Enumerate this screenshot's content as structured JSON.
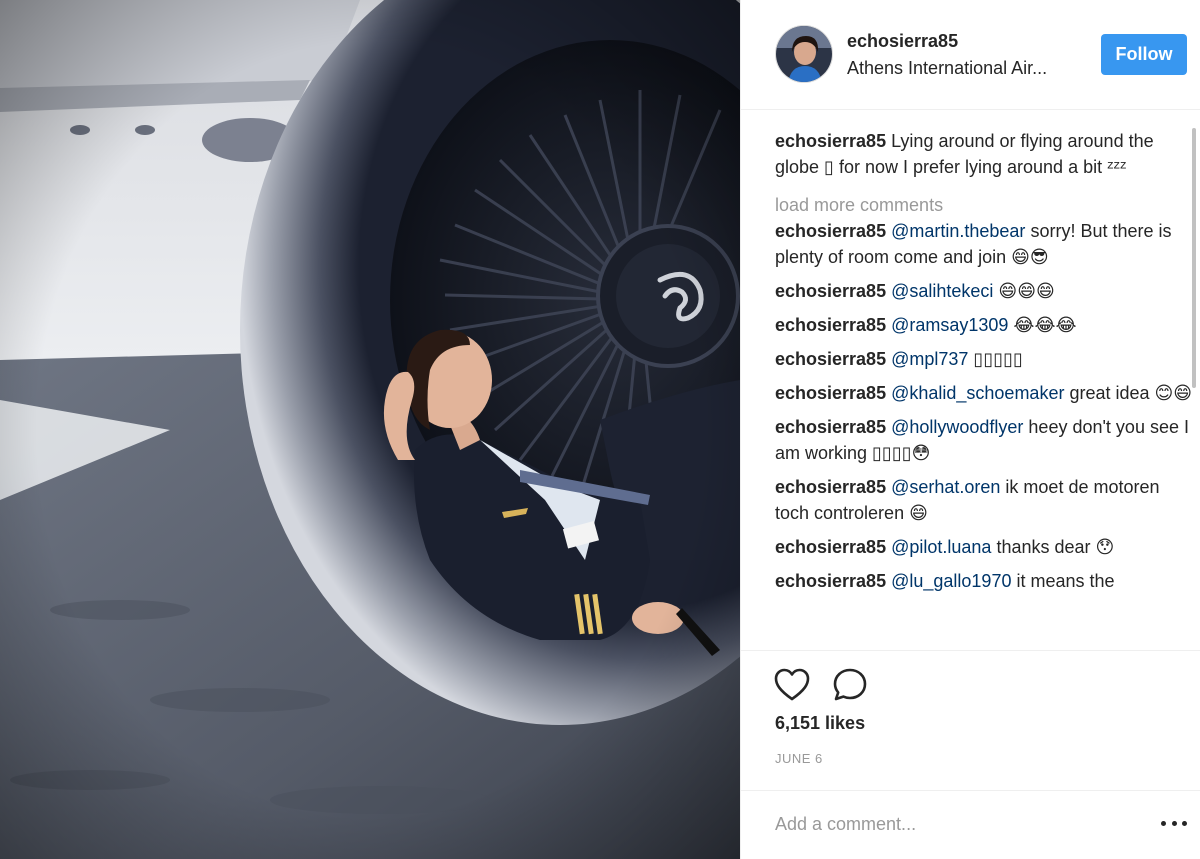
{
  "post": {
    "username": "echosierra85",
    "location": "Athens International Air...",
    "follow_label": "Follow",
    "caption": {
      "user": "echosierra85",
      "text": "Lying around or flying around the globe ▯ for now I prefer lying around a bit ᶻᶻᶻ"
    },
    "load_more": "load more comments",
    "comments": [
      {
        "user": "echosierra85",
        "mention": "@martin.thebear",
        "text": " sorry! But there is plenty of room come and join 😄😎"
      },
      {
        "user": "echosierra85",
        "mention": "@salihtekeci",
        "text": " 😄😄😄"
      },
      {
        "user": "echosierra85",
        "mention": "@ramsay1309",
        "text": " 😂😂😂"
      },
      {
        "user": "echosierra85",
        "mention": "@mpl737",
        "text": " ▯▯▯▯▯"
      },
      {
        "user": "echosierra85",
        "mention": "@khalid_schoemaker",
        "text": " great idea 😊😄"
      },
      {
        "user": "echosierra85",
        "mention": "@hollywoodflyer",
        "text": " heey don't you see I am working ▯▯▯▯😳"
      },
      {
        "user": "echosierra85",
        "mention": "@serhat.oren",
        "text": " ik moet de motoren toch controleren 😄"
      },
      {
        "user": "echosierra85",
        "mention": "@pilot.luana",
        "text": " thanks dear 😯"
      },
      {
        "user": "echosierra85",
        "mention": "@lu_gallo1970",
        "text": " it means the"
      }
    ],
    "likes": "6,151 likes",
    "date": "JUNE 6",
    "add_comment_placeholder": "Add a comment..."
  },
  "icons": {
    "like": "heart-icon",
    "comment": "speech-bubble-icon",
    "more": "more-options-icon"
  },
  "colors": {
    "follow_button": "#3897f0",
    "mention": "#003569",
    "muted": "#999999"
  }
}
